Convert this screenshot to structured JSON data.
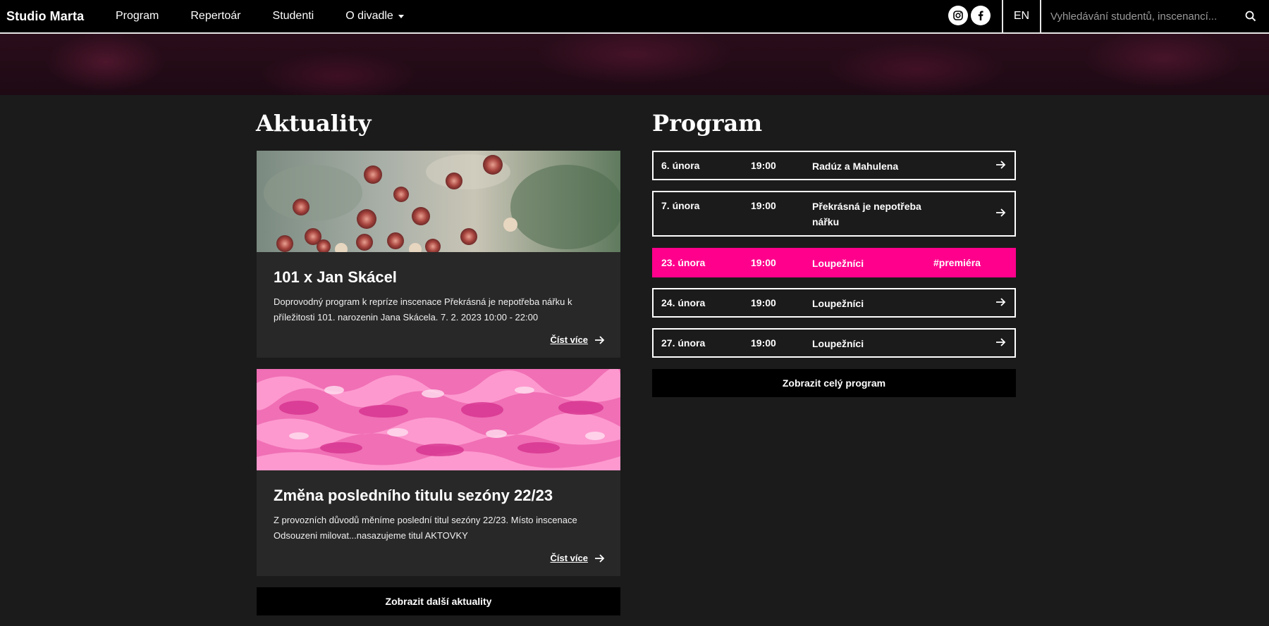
{
  "nav": {
    "brand": "Studio Marta",
    "links": [
      "Program",
      "Repertoár",
      "Studenti",
      "O divadle"
    ],
    "lang": "EN",
    "search_placeholder": "Vyhledávání studentů, inscenancí..."
  },
  "icons": {
    "instagram": "instagram-icon",
    "facebook": "facebook-icon",
    "search": "search-icon",
    "arrow": "arrow-right-icon"
  },
  "colors": {
    "accent": "#ff008c",
    "background": "#1b1b1b",
    "card": "#282828"
  },
  "news": {
    "title": "Aktuality",
    "items": [
      {
        "title": "101 x Jan Skácel",
        "text": "Doprovodný program k repríze inscenace Překrásná je nepotřeba nářku k příležitosti 101. narozenin Jana Skácela. 7. 2. 2023 10:00 - 22:00",
        "link": "Číst více"
      },
      {
        "title": "Změna posledního titulu sezóny 22/23",
        "text": "Z provozních důvodů měníme poslední titul sezóny 22/23. Místo inscenace Odsouzeni milovat...nasazujeme titul AKTOVKY",
        "link": "Číst více"
      }
    ],
    "more_button": "Zobrazit další aktuality"
  },
  "program": {
    "title": "Program",
    "items": [
      {
        "date": "6. února",
        "time": "19:00",
        "title": "Radúz a Mahulena",
        "tag": ""
      },
      {
        "date": "7. února",
        "time": "19:00",
        "title": "Překrásná je nepotřeba nářku",
        "tag": ""
      },
      {
        "date": "23. února",
        "time": "19:00",
        "title": "Loupežníci",
        "tag": "#premiéra"
      },
      {
        "date": "24. února",
        "time": "19:00",
        "title": "Loupežníci",
        "tag": ""
      },
      {
        "date": "27. února",
        "time": "19:00",
        "title": "Loupežníci",
        "tag": ""
      }
    ],
    "full_button": "Zobrazit celý program"
  }
}
